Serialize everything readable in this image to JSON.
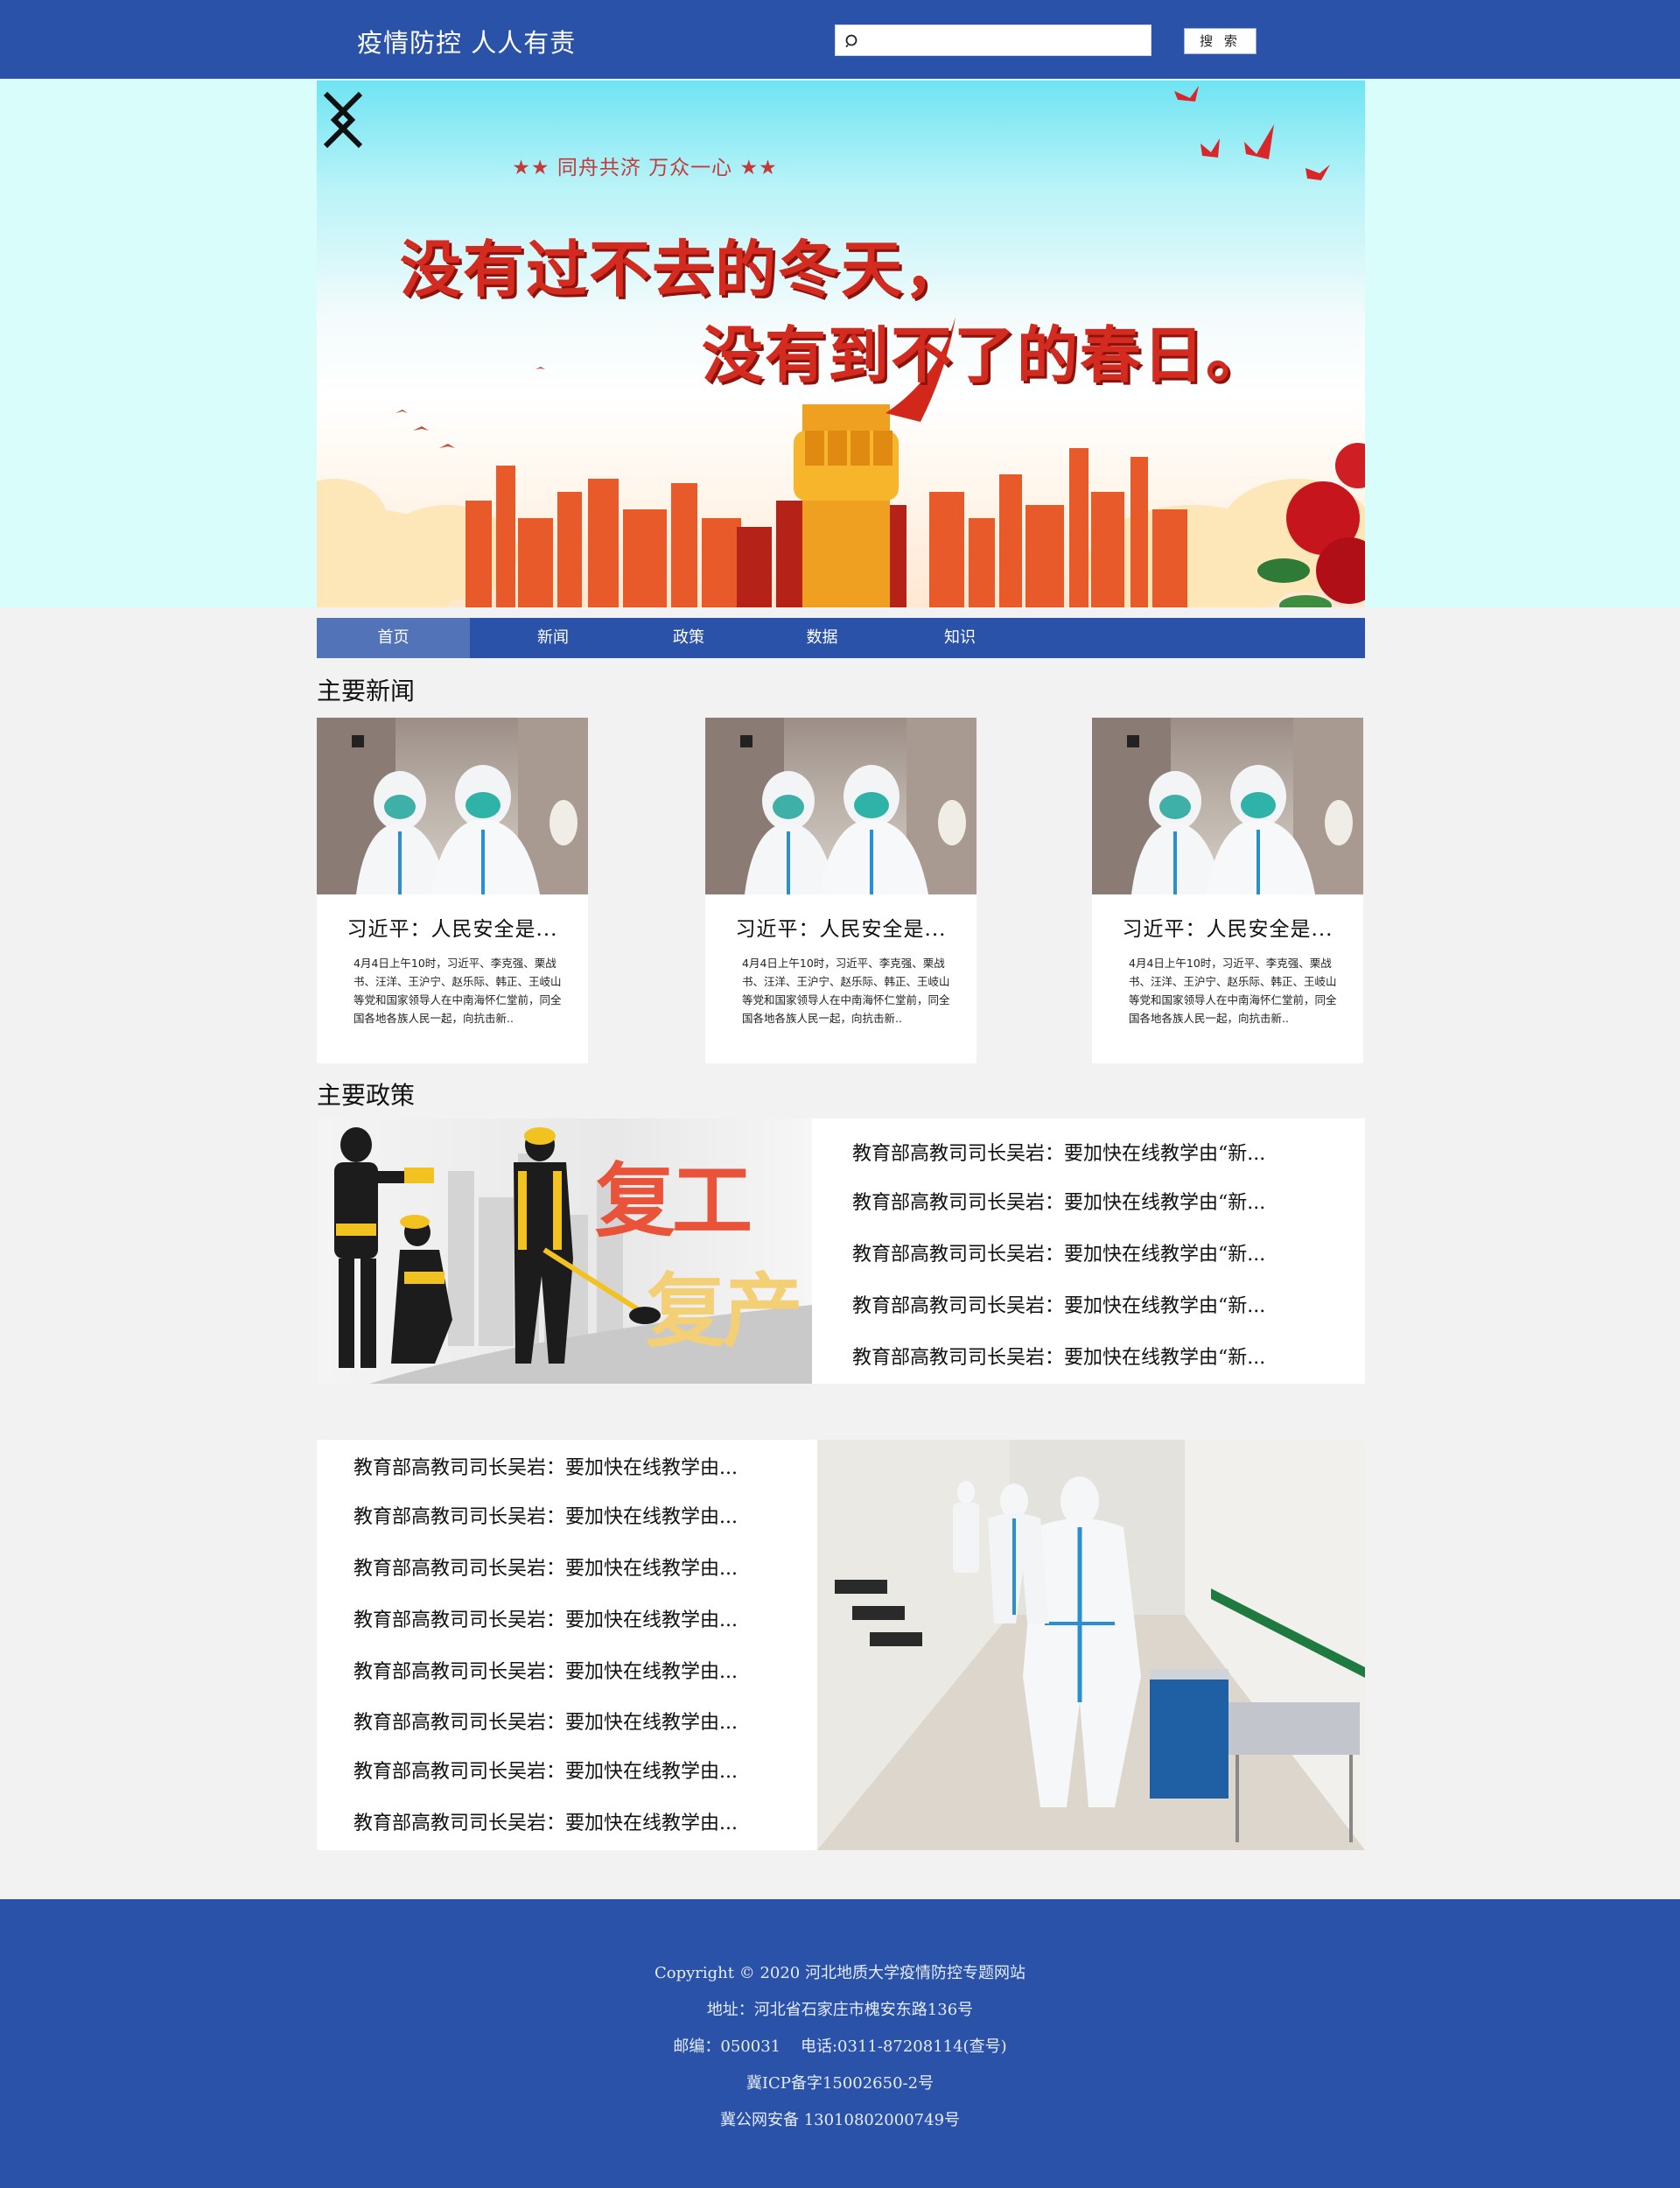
{
  "header": {
    "title": "疫情防控  人人有责",
    "search_placeholder": "",
    "search_button": "搜 索"
  },
  "banner": {
    "tagline": "★★ 同舟共济 万众一心 ★★",
    "line1": "没有过不去的冬天，",
    "line2": "没有到不了的春日。"
  },
  "nav": {
    "items": [
      {
        "label": "首页"
      },
      {
        "label": "新闻"
      },
      {
        "label": "政策"
      },
      {
        "label": "数据"
      },
      {
        "label": "知识"
      }
    ]
  },
  "news_section": {
    "title": "主要新闻",
    "cards": [
      {
        "title": "习近平：人民安全是...",
        "summary": "4月4日上午10时，习近平、李克强、栗战书、汪洋、王沪宁、赵乐际、韩正、王岐山等党和国家领导人在中南海怀仁堂前，同全国各地各族人民一起，向抗击新.."
      },
      {
        "title": "习近平：人民安全是...",
        "summary": "4月4日上午10时，习近平、李克强、栗战书、汪洋、王沪宁、赵乐际、韩正、王岐山等党和国家领导人在中南海怀仁堂前，同全国各地各族人民一起，向抗击新.."
      },
      {
        "title": "习近平：人民安全是...",
        "summary": "4月4日上午10时，习近平、李克强、栗战书、汪洋、王沪宁、赵乐际、韩正、王岐山等党和国家领导人在中南海怀仁堂前，同全国各地各族人民一起，向抗击新.."
      }
    ]
  },
  "policy_section": {
    "title": "主要政策",
    "image_text": [
      "复工",
      "复产"
    ],
    "links": [
      "教育部高教司司长吴岩：要加快在线教学由“新...",
      "教育部高教司司长吴岩：要加快在线教学由“新...",
      "教育部高教司司长吴岩：要加快在线教学由“新...",
      "教育部高教司司长吴岩：要加快在线教学由“新...",
      "教育部高教司司长吴岩：要加快在线教学由“新..."
    ]
  },
  "news2_section": {
    "links": [
      "教育部高教司司长吴岩：要加快在线教学由...",
      "教育部高教司司长吴岩：要加快在线教学由...",
      "教育部高教司司长吴岩：要加快在线教学由...",
      "教育部高教司司长吴岩：要加快在线教学由...",
      "教育部高教司司长吴岩：要加快在线教学由...",
      "教育部高教司司长吴岩：要加快在线教学由...",
      "教育部高教司司长吴岩：要加快在线教学由...",
      "教育部高教司司长吴岩：要加快在线教学由..."
    ]
  },
  "footer": {
    "copyright": "Copyright © 2020 河北地质大学疫情防控专题网站",
    "address": "地址：河北省石家庄市槐安东路136号",
    "contact": "邮编：050031    电话:0311-87208114(查号)",
    "icp": "冀ICP备字15002650-2号",
    "police": "冀公网安备 13010802000749号"
  },
  "colors": {
    "brand_blue": "#2a52a8",
    "nav_active": "#5273b8",
    "banner_band": "#d8fdfa",
    "page_bg": "#f2f2f2",
    "banner_red": "#d32b1f"
  },
  "icons": [
    "search-icon",
    "chevron-left-icon",
    "chevron-right-icon"
  ]
}
